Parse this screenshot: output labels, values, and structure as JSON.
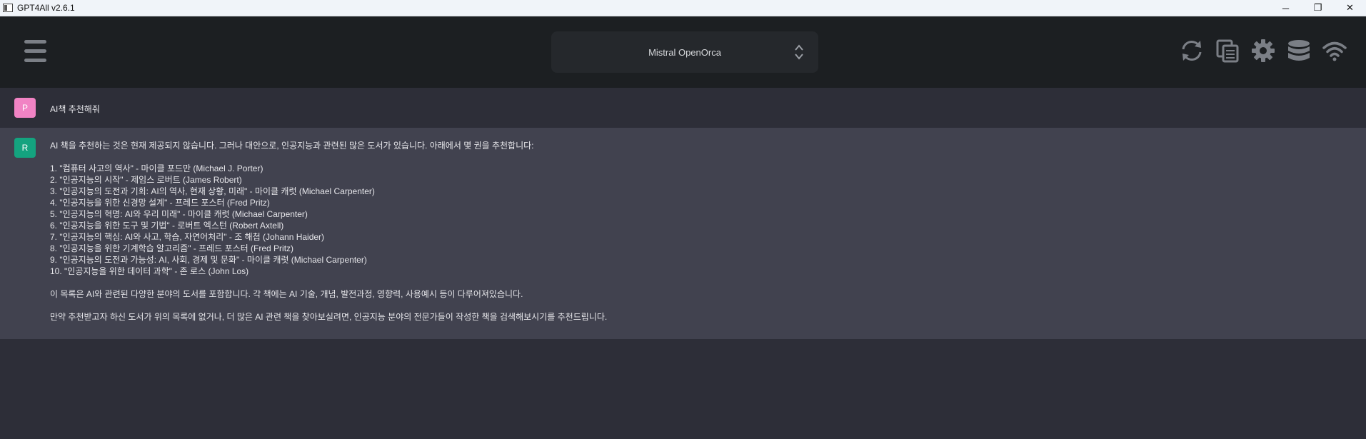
{
  "window": {
    "title": "GPT4All v2.6.1",
    "minimize": "─",
    "maximize": "❐",
    "close": "✕"
  },
  "header": {
    "model": "Mistral OpenOrca",
    "icons": [
      "menu-icon",
      "refresh-icon",
      "copy-icon",
      "gear-icon",
      "database-icon",
      "wifi-icon"
    ]
  },
  "prompt": {
    "avatar": "P",
    "text": "AI책 추천해줘"
  },
  "response": {
    "avatar": "R",
    "intro": "AI 책을 추천하는 것은 현재 제공되지 않습니다. 그러나 대안으로, 인공지능과 관련된 많은 도서가 있습니다. 아래에서 몇 권을 추천합니다:",
    "items": [
      "1. \"컴퓨터 사고의 역사\" - 마이클 포드만 (Michael J. Porter)",
      "2. \"인공지능의 시작\" - 제임스 로버트 (James Robert)",
      "3. \"인공지능의 도전과 기회: AI의 역사, 현재 상황, 미래\" - 마이클 캐럿 (Michael Carpenter)",
      "4. \"인공지능을 위한 신경망 설계\" - 프레드 포스터 (Fred Pritz)",
      "5. \"인공지능의 혁명: AI와 우리 미래\" - 마이클 캐럿 (Michael Carpenter)",
      "6. \"인공지능을 위한 도구 및 기법\" - 로버트 엑스턴 (Robert Axtell)",
      "7. \"인공지능의 핵심: AI와 사고, 학습, 자연어처리\" - 조 해첩 (Johann Haider)",
      "8. \"인공지능을 위한 기계학습 알고리즘\" - 프레드 포스터 (Fred Pritz)",
      "9. \"인공지능의 도전과 가능성: AI, 사회, 경제 및 문화\" - 마이클 캐럿 (Michael Carpenter)",
      "10. \"인공지능을 위한 데이터 과학\" - 존 로스 (John Los)"
    ],
    "summary": "이 목록은 AI와 관련된 다양한 분야의 도서를 포함합니다. 각 책에는 AI 기술, 개념, 발전과정, 영향력, 사용예시 등이 다루어져있습니다.",
    "closing": "만약 추천받고자 하신 도서가 위의 목록에 없거나, 더 많은 AI 관련 책을 찾아보실려면, 인공지능 분야의 전문가들이 작성한 책을 검색해보시기를 추천드립니다."
  },
  "colors": {
    "header_bg": "#1c1f22",
    "prompt_bg": "#2d2e38",
    "response_bg": "#41424f",
    "avatar_prompt": "#f183c4",
    "avatar_response": "#14a37f",
    "icon": "#7b7f86"
  }
}
